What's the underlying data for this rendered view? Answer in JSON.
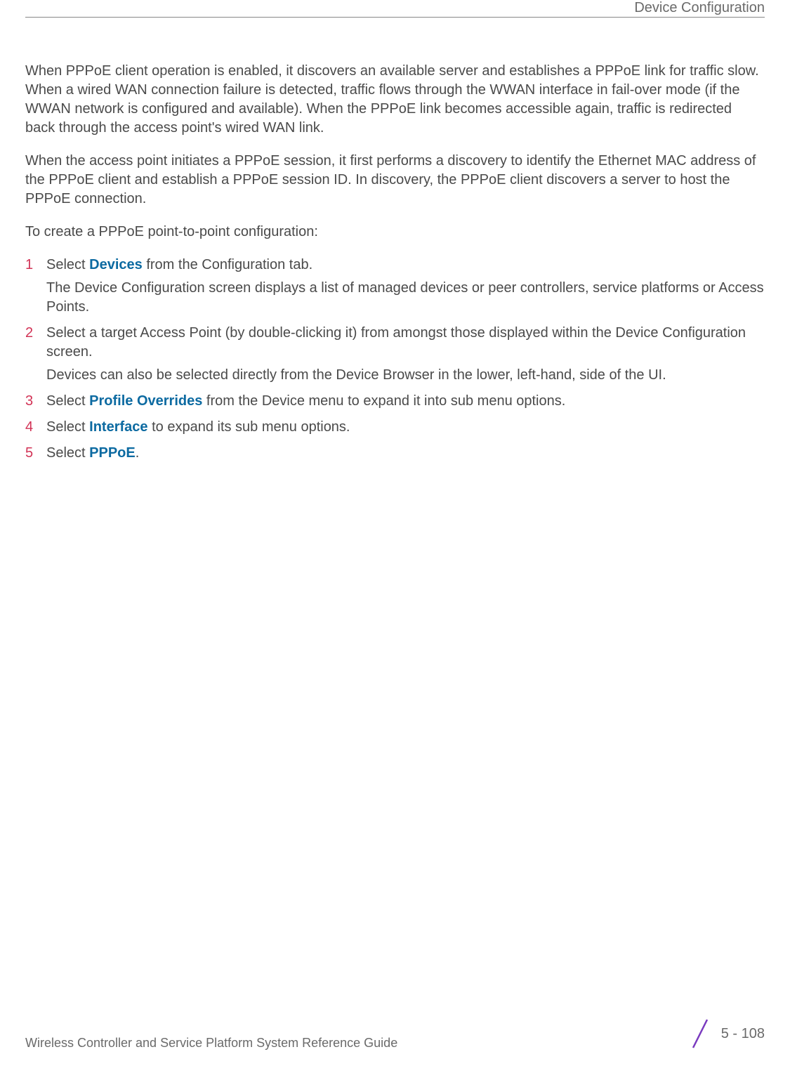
{
  "header": {
    "title": "Device Configuration"
  },
  "paragraphs": {
    "p1": "When PPPoE client operation is enabled, it discovers an available server and establishes a PPPoE link for traffic slow. When a wired WAN connection failure is detected, traffic flows through the WWAN interface in fail-over mode (if the WWAN network is configured and available). When the PPPoE link becomes accessible again, traffic is redirected back through the access point's wired WAN link.",
    "p2": "When the access point initiates a PPPoE session, it first performs a discovery to identify the Ethernet MAC address of the PPPoE client and establish a PPPoE session ID. In discovery, the PPPoE client discovers a server to host the PPPoE connection.",
    "p3": "To create a PPPoE point-to-point configuration:"
  },
  "steps": [
    {
      "num": "1",
      "segments": [
        {
          "text": "Select ",
          "style": "normal"
        },
        {
          "text": "Devices",
          "style": "bold-blue"
        },
        {
          "text": " from the Configuration tab.",
          "style": "normal"
        }
      ],
      "sub": "The Device Configuration screen displays a list of managed devices or peer controllers, service platforms or Access Points."
    },
    {
      "num": "2",
      "segments": [
        {
          "text": "Select a target Access Point (by double-clicking it) from amongst those displayed within the Device Configuration screen.",
          "style": "normal"
        }
      ],
      "sub": "Devices can also be selected directly from the Device Browser in the lower, left-hand, side of the UI."
    },
    {
      "num": "3",
      "segments": [
        {
          "text": "Select ",
          "style": "normal"
        },
        {
          "text": "Profile Overrides",
          "style": "bold-blue"
        },
        {
          "text": " from the Device menu to expand it into sub menu options.",
          "style": "normal"
        }
      ]
    },
    {
      "num": "4",
      "segments": [
        {
          "text": "Select ",
          "style": "normal"
        },
        {
          "text": "Interface",
          "style": "bold-blue"
        },
        {
          "text": " to expand its sub menu options.",
          "style": "normal"
        }
      ]
    },
    {
      "num": "5",
      "segments": [
        {
          "text": "Select ",
          "style": "normal"
        },
        {
          "text": "PPPoE",
          "style": "bold-blue"
        },
        {
          "text": ".",
          "style": "normal"
        }
      ]
    }
  ],
  "footer": {
    "text": "Wireless Controller and Service Platform System Reference Guide",
    "page": "5 - 108"
  }
}
